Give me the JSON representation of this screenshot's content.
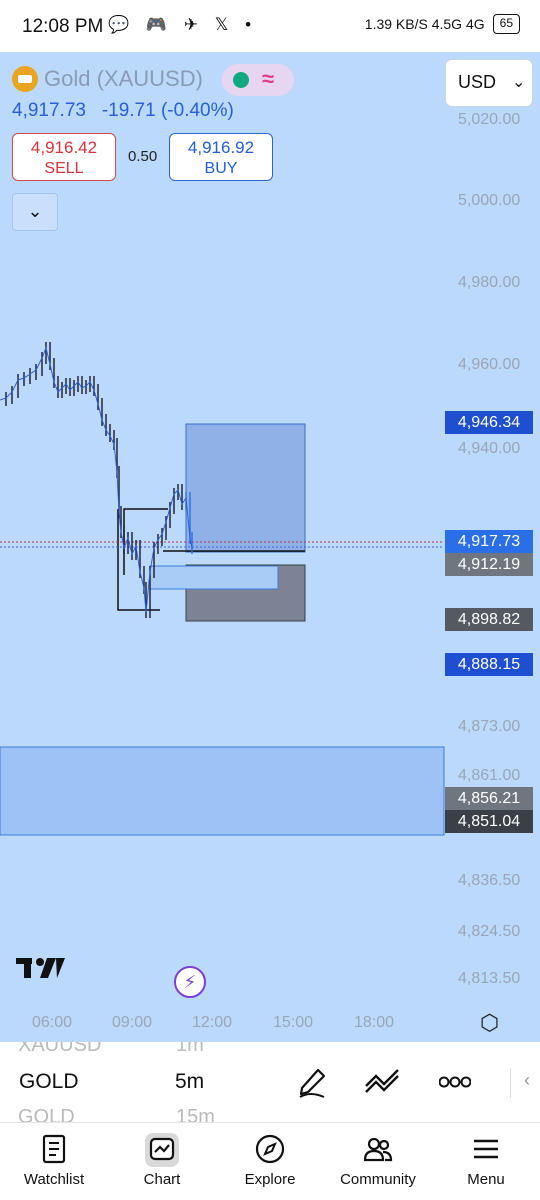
{
  "status_bar": {
    "time": "12:08 PM",
    "notification_icons": "💬 🎮 ✈ 𝕏 •",
    "right_text": "1.39 KB/S  4.5G  4G",
    "battery": "65"
  },
  "header": {
    "symbol": "Gold (XAUUSD)",
    "currency": "USD",
    "last_price": "4,917.73",
    "change": "-19.71",
    "change_pct": "(-0.40%)"
  },
  "trade": {
    "sell_price": "4,916.42",
    "sell_label": "SELL",
    "spread": "0.50",
    "buy_price": "4,916.92",
    "buy_label": "BUY"
  },
  "price_axis": [
    "5,020.00",
    "5,000.00",
    "4,980.00",
    "4,960.00",
    "4,940.00",
    "4,873.00",
    "4,861.00",
    "4,836.50",
    "4,824.50",
    "4,813.50"
  ],
  "price_tags": {
    "t1": "4,946.34",
    "t2": "4,917.73",
    "t3": "4,912.19",
    "t4": "4,898.82",
    "t5": "4,888.15",
    "t6": "4,856.21",
    "t7": "4,851.04"
  },
  "time_axis": [
    "06:00",
    "09:00",
    "12:00",
    "15:00",
    "18:00"
  ],
  "toolbar": {
    "prev_symbol": "XAUUSD",
    "prev_interval": "1m",
    "symbol": "GOLD",
    "interval": "5m",
    "next_symbol": "GOLD",
    "next_interval": "15m"
  },
  "nav": {
    "watchlist": "Watchlist",
    "chart": "Chart",
    "explore": "Explore",
    "community": "Community",
    "menu": "Menu"
  },
  "colors": {
    "chart_bg": "#bbd9fb",
    "sell": "#d9323a",
    "buy": "#2060d4",
    "tag_blue": "#1f4fd1",
    "tag_gray": "#545962"
  },
  "chart_data": {
    "type": "candlestick",
    "title": "",
    "ylabel": "",
    "ylim": [
      4813.5,
      5020
    ],
    "x_ticks": [
      "06:00",
      "09:00",
      "12:00",
      "15:00",
      "18:00"
    ],
    "last": 4917.73,
    "levels": [
      4946.34,
      4917.73,
      4912.19,
      4898.82,
      4888.15,
      4856.21,
      4851.04
    ]
  }
}
